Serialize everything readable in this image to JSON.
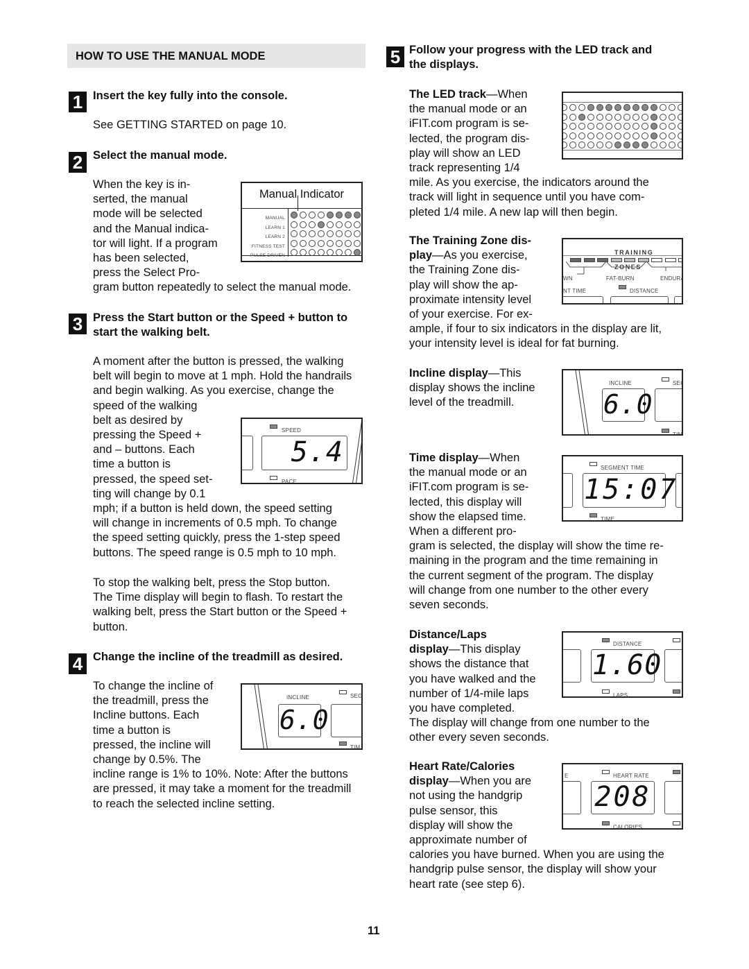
{
  "left_column": {
    "section_title": "HOW TO USE THE MANUAL MODE",
    "steps": [
      {
        "number": "1",
        "heading": "Insert the key fully into the console.",
        "body": [
          "See GETTING STARTED on page 10."
        ]
      },
      {
        "number": "2",
        "heading": "Select the manual mode.",
        "body_lines": [
          "When the key is in-",
          "serted, the manual",
          "mode will be selected",
          "and the Manual indica-",
          "tor will light. If a program",
          "has been selected,",
          "press the Select Pro-",
          "gram button repeatedly to select the manual mode."
        ]
      },
      {
        "number": "3",
        "heading_lines": [
          "Press the Start button or the Speed + button to",
          "start the walking belt."
        ],
        "body_lines": [
          "A moment after the button is pressed, the walking",
          "belt will begin to move at 1 mph. Hold the handrails",
          "and begin walking. As you exercise, change the",
          "speed of the walking",
          "belt as desired by",
          "pressing the Speed +",
          "and – buttons. Each",
          "time a button is",
          "pressed, the speed set-",
          "ting will change by 0.1",
          "mph; if a button is held down, the speed setting",
          "will change in increments of 0.5 mph. To change",
          "the speed setting quickly, press the 1-step speed",
          "buttons. The speed range is 0.5 mph to 10 mph."
        ],
        "body2_lines": [
          "To stop the walking belt, press the Stop button.",
          "The Time display will begin to flash. To restart the",
          "walking belt, press the Start button or the Speed +",
          "button."
        ]
      },
      {
        "number": "4",
        "heading": "Change the incline of the treadmill as desired.",
        "body_lines": [
          "To change the incline of",
          "the treadmill, press the",
          "Incline buttons. Each",
          "time a button is",
          "pressed, the incline will",
          "change by 0.5%. The",
          "incline range is 1% to 10%. Note: After the buttons",
          "are pressed, it may take a moment for the treadmill",
          "to reach the selected incline setting."
        ]
      }
    ],
    "figures": {
      "manual_indicator": {
        "caption": "Manual Indicator",
        "rows": [
          {
            "label": "MANUAL",
            "lit": [
              0,
              4,
              5,
              6,
              7
            ]
          },
          {
            "label": "LEARN 1",
            "lit": [
              3
            ]
          },
          {
            "label": "LEARN 2",
            "lit": []
          },
          {
            "label": "FITNESS TEST",
            "lit": []
          },
          {
            "label": "PULSE DRIVEN",
            "lit": [
              7
            ]
          }
        ]
      },
      "speed_display": {
        "top_label": "SPEED",
        "bottom_label": "PACE",
        "value": "5.4"
      },
      "incline_display_step4": {
        "top_label": "INCLINE",
        "right_top_label": "SEG",
        "right_bottom_label": "TIM",
        "value": "6.0"
      }
    }
  },
  "right_column": {
    "step5": {
      "number": "5",
      "heading_lines": [
        "Follow your progress with the LED track and",
        "the displays."
      ]
    },
    "items": [
      {
        "title": "The LED track",
        "lines": [
          "—When",
          "the manual mode or an",
          "iFIT.com program is se-",
          "lected, the program dis-",
          "play will show an LED",
          "track representing 1/4",
          "mile. As you exercise, the indicators around the",
          "track will light in sequence until you have com-",
          "pleted 1/4 mile. A new lap will then begin."
        ]
      },
      {
        "title_lines": [
          "The Training Zone dis-",
          "play"
        ],
        "lines": [
          "—As you exercise,",
          "the Training Zone dis-",
          "play will show the ap-",
          "proximate intensity level",
          "of your exercise. For ex-",
          "ample, if four to six indicators in the display are lit,",
          "your intensity level is ideal for fat burning."
        ]
      },
      {
        "title": "Incline display",
        "lines": [
          "—This",
          "display shows the incline",
          "level of the treadmill."
        ]
      },
      {
        "title": "Time display",
        "lines": [
          "—When",
          "the manual mode or an",
          "iFIT.com program is se-",
          "lected, this display will",
          "show the elapsed time.",
          "When a different pro-",
          "gram is selected, the display will show the time re-",
          "maining in the program and the time remaining in",
          "the current segment of the program. The display",
          "will change from one number to the other every",
          "seven seconds."
        ]
      },
      {
        "title_lines": [
          "Distance/Laps",
          "display"
        ],
        "lines": [
          "—This display",
          "shows the distance that",
          "you have walked and the",
          "number of 1/4-mile laps",
          "you have completed.",
          "The display will change from one number to the",
          "other every seven seconds."
        ]
      },
      {
        "title_lines": [
          "Heart Rate/Calories",
          "display"
        ],
        "lines": [
          "—When you are",
          "not using the handgrip",
          "pulse sensor, this",
          "display will show the",
          "approximate number of",
          "calories you have burned. When you are using the",
          "handgrip pulse sensor, the display will show your",
          "heart rate (see step 6)."
        ]
      }
    ],
    "figures": {
      "led_track": {
        "rows_lit": [
          [
            3,
            4,
            5,
            6,
            7,
            8,
            9,
            10
          ],
          [
            2,
            10
          ],
          [
            10
          ],
          [
            10
          ],
          [
            6,
            7,
            8,
            9
          ]
        ]
      },
      "training_zones": {
        "title": "TRAINING ZONES",
        "segments": [
          "dark",
          "dark",
          "dark",
          "light",
          "light",
          "light",
          "off",
          "off",
          "off"
        ],
        "zone_labels": [
          "WN",
          "FAT-BURN",
          "ENDURA"
        ],
        "bottom_left_label": "NT TIME",
        "bottom_label": "DISTANCE"
      },
      "incline_display": {
        "top_label": "INCLINE",
        "right_top_label": "SEG",
        "right_bottom_label": "TIM",
        "value": "6.0"
      },
      "time_display": {
        "top_label": "SEGMENT TIME",
        "bottom_label": "TIME",
        "value": "15:07"
      },
      "distance_display": {
        "top_label": "DISTANCE",
        "bottom_label": "LAPS",
        "value": "1.60"
      },
      "heart_display": {
        "top_label": "HEART RATE",
        "bottom_label": "CALORIES",
        "left_label": "E",
        "value": "208"
      }
    }
  },
  "page_number": "11"
}
